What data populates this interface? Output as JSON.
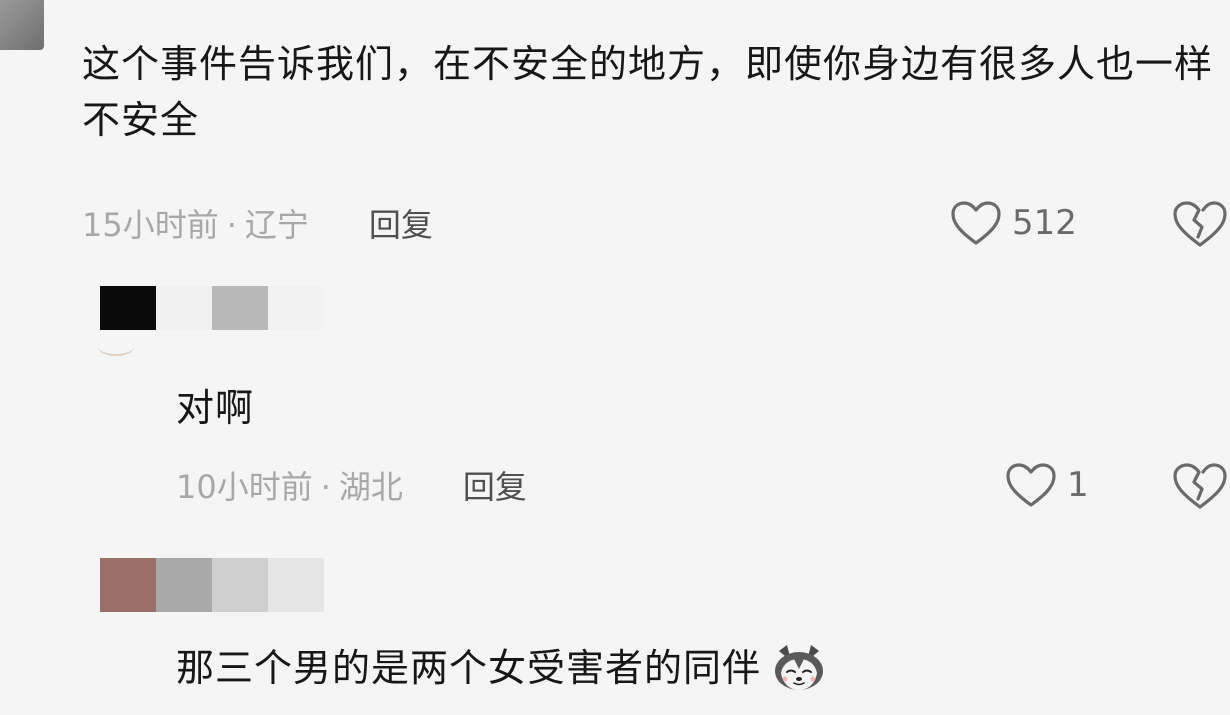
{
  "comments": [
    {
      "text": "这个事件告诉我们，在不安全的地方，即使你身边有很多人也一样不安全",
      "time": "15小时前",
      "separator": "·",
      "location": "辽宁",
      "reply_label": "回复",
      "likes": "512"
    },
    {
      "text": "对啊",
      "time": "10小时前",
      "separator": "·",
      "location": "湖北",
      "reply_label": "回复",
      "likes": "1"
    },
    {
      "text": "那三个男的是两个女受害者的同伴",
      "emoji": "husky-dog-emoji"
    }
  ],
  "icons": {
    "like": "heart-outline-icon",
    "dislike": "broken-heart-icon"
  },
  "colors": {
    "background": "#f5f5f5",
    "text": "#171717",
    "meta": "#a8a8a8",
    "reply": "#4f4f4f",
    "icon": "#6a6a6a",
    "mosaic_1": [
      "#0a0a0a",
      "#f0f0f0",
      "#b9b9b9",
      "#f2f2f2"
    ],
    "mosaic_2": [
      "#9a6f69",
      "#a9a9a9",
      "#cfcfcf",
      "#e6e6e6"
    ]
  }
}
